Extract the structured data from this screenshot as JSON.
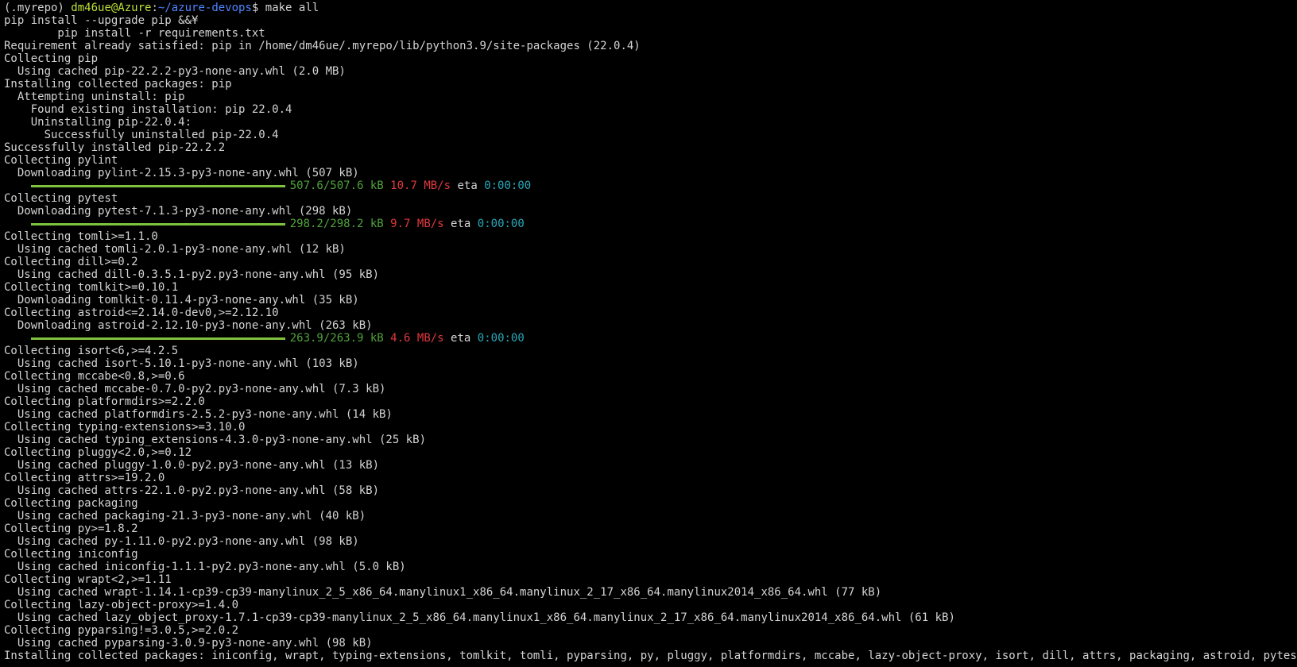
{
  "prompt": {
    "venv": "(.myrepo) ",
    "user_host": "dm46ue@Azure",
    "sep": ":",
    "path": "~/azure-devops",
    "symbol": "$ ",
    "command": "make all"
  },
  "lines": [
    "pip install --upgrade pip &&¥",
    "        pip install -r requirements.txt",
    "Requirement already satisfied: pip in /home/dm46ue/.myrepo/lib/python3.9/site-packages (22.0.4)",
    "Collecting pip",
    "  Using cached pip-22.2.2-py3-none-any.whl (2.0 MB)",
    "Installing collected packages: pip",
    "  Attempting uninstall: pip",
    "    Found existing installation: pip 22.0.4",
    "    Uninstalling pip-22.0.4:",
    "      Successfully uninstalled pip-22.0.4",
    "Successfully installed pip-22.2.2",
    "Collecting pylint",
    "  Downloading pylint-2.15.3-py3-none-any.whl (507 kB)",
    "Collecting pytest",
    "  Downloading pytest-7.1.3-py3-none-any.whl (298 kB)",
    "Collecting tomli>=1.1.0",
    "  Using cached tomli-2.0.1-py3-none-any.whl (12 kB)",
    "Collecting dill>=0.2",
    "  Using cached dill-0.3.5.1-py2.py3-none-any.whl (95 kB)",
    "Collecting tomlkit>=0.10.1",
    "  Downloading tomlkit-0.11.4-py3-none-any.whl (35 kB)",
    "Collecting astroid<=2.14.0-dev0,>=2.12.10",
    "  Downloading astroid-2.12.10-py3-none-any.whl (263 kB)",
    "Collecting isort<6,>=4.2.5",
    "  Using cached isort-5.10.1-py3-none-any.whl (103 kB)",
    "Collecting mccabe<0.8,>=0.6",
    "  Using cached mccabe-0.7.0-py2.py3-none-any.whl (7.3 kB)",
    "Collecting platformdirs>=2.2.0",
    "  Using cached platformdirs-2.5.2-py3-none-any.whl (14 kB)",
    "Collecting typing-extensions>=3.10.0",
    "  Using cached typing_extensions-4.3.0-py3-none-any.whl (25 kB)",
    "Collecting pluggy<2.0,>=0.12",
    "  Using cached pluggy-1.0.0-py2.py3-none-any.whl (13 kB)",
    "Collecting attrs>=19.2.0",
    "  Using cached attrs-22.1.0-py2.py3-none-any.whl (58 kB)",
    "Collecting packaging",
    "  Using cached packaging-21.3-py3-none-any.whl (40 kB)",
    "Collecting py>=1.8.2",
    "  Using cached py-1.11.0-py2.py3-none-any.whl (98 kB)",
    "Collecting iniconfig",
    "  Using cached iniconfig-1.1.1-py2.py3-none-any.whl (5.0 kB)",
    "Collecting wrapt<2,>=1.11",
    "  Using cached wrapt-1.14.1-cp39-cp39-manylinux_2_5_x86_64.manylinux1_x86_64.manylinux_2_17_x86_64.manylinux2014_x86_64.whl (77 kB)",
    "Collecting lazy-object-proxy>=1.4.0",
    "  Using cached lazy_object_proxy-1.7.1-cp39-cp39-manylinux_2_5_x86_64.manylinux1_x86_64.manylinux_2_17_x86_64.manylinux2014_x86_64.whl (61 kB)",
    "Collecting pyparsing!=3.0.5,>=2.0.2",
    "  Using cached pyparsing-3.0.9-py3-none-any.whl (98 kB)",
    "Installing collected packages: iniconfig, wrapt, typing-extensions, tomlkit, tomli, pyparsing, py, pluggy, platformdirs, mccabe, lazy-object-proxy, isort, dill, attrs, packaging, astroid, pytest, pylint"
  ],
  "progress": [
    {
      "size": "507.6/507.6 kB",
      "speed": "10.7 MB/s",
      "eta_label": "eta",
      "eta": "0:00:00",
      "fraction": 1.0
    },
    {
      "size": "298.2/298.2 kB",
      "speed": "9.7 MB/s",
      "eta_label": "eta",
      "eta": "0:00:00",
      "fraction": 1.0
    },
    {
      "size": "263.9/263.9 kB",
      "speed": "4.6 MB/s",
      "eta_label": "eta",
      "eta": "0:00:00",
      "fraction": 1.0
    }
  ],
  "colors": {
    "background": "#000000",
    "text": "#d4d4d4",
    "user_host": "#bde33a",
    "path": "#4d86ff",
    "progress_bar": "#7ec23f",
    "size": "#4fa33a",
    "speed": "#e0393e",
    "eta_value": "#2aa8b8"
  }
}
